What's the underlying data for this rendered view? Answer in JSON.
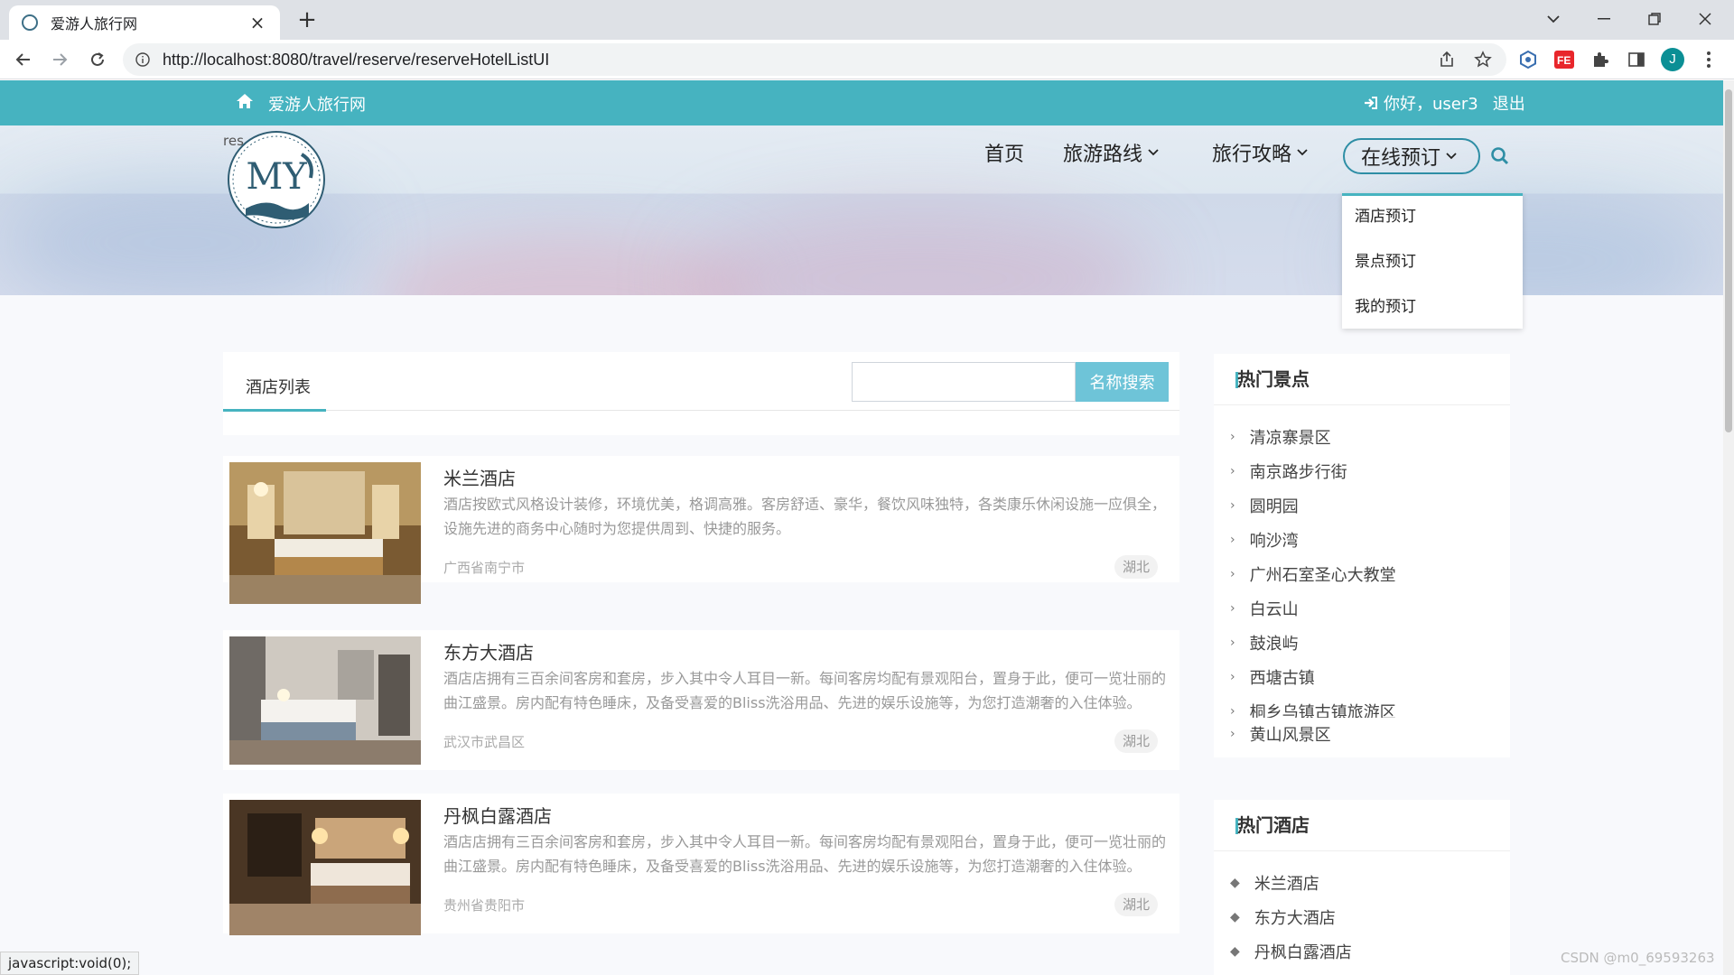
{
  "browser": {
    "tab_title": "爱游人旅行网",
    "url": "http://localhost:8080/travel/reserve/reserveHotelListUI",
    "profile_initial": "J",
    "status_text": "javascript:void(0);"
  },
  "site": {
    "name": "爱游人旅行网",
    "greeting": "你好，user3",
    "logout": "退出",
    "logo_text": "res",
    "logo_letters": "MY"
  },
  "nav": {
    "home": "首页",
    "routes": "旅游路线",
    "guides": "旅行攻略",
    "reserve": "在线预订",
    "dropdown": [
      "酒店预订",
      "景点预订",
      "我的预订"
    ]
  },
  "list": {
    "tab": "酒店列表",
    "search_placeholder": "",
    "search_button": "名称搜索",
    "hotels": [
      {
        "name": "米兰酒店",
        "desc": "酒店按欧式风格设计装修，环境优美，格调高雅。客房舒适、豪华，餐饮风味独特，各类康乐休闲设施一应俱全，设施先进的商务中心随时为您提供周到、快捷的服务。",
        "location": "广西省南宁市",
        "tag": "湖北"
      },
      {
        "name": "东方大酒店",
        "desc": "酒店店拥有三百余间客房和套房，步入其中令人耳目一新。每间客房均配有景观阳台，置身于此，便可一览壮丽的曲江盛景。房内配有特色睡床，及备受喜爱的Bliss洗浴用品、先进的娱乐设施等，为您打造潮奢的入住体验。",
        "location": "武汉市武昌区",
        "tag": "湖北"
      },
      {
        "name": "丹枫白露酒店",
        "desc": "酒店店拥有三百余间客房和套房，步入其中令人耳目一新。每间客房均配有景观阳台，置身于此，便可一览壮丽的曲江盛景。房内配有特色睡床，及备受喜爱的Bliss洗浴用品、先进的娱乐设施等，为您打造潮奢的入住体验。",
        "location": "贵州省贵阳市",
        "tag": "湖北"
      }
    ]
  },
  "sidebar": {
    "spots_title": "热门景点",
    "spots": [
      "清凉寨景区",
      "南京路步行街",
      "圆明园",
      "响沙湾",
      "广州石室圣心大教堂",
      "白云山",
      "鼓浪屿",
      "西塘古镇",
      "桐乡乌镇古镇旅游区",
      "黄山风景区"
    ],
    "hotels_title": "热门酒店",
    "hotels": [
      "米兰酒店",
      "东方大酒店",
      "丹枫白露酒店"
    ]
  },
  "credit": "CSDN @m0_69593263",
  "colors": {
    "accent": "#46b3c0",
    "nav_active_border": "#2e8ea5",
    "search_button": "#6ec4d8"
  }
}
